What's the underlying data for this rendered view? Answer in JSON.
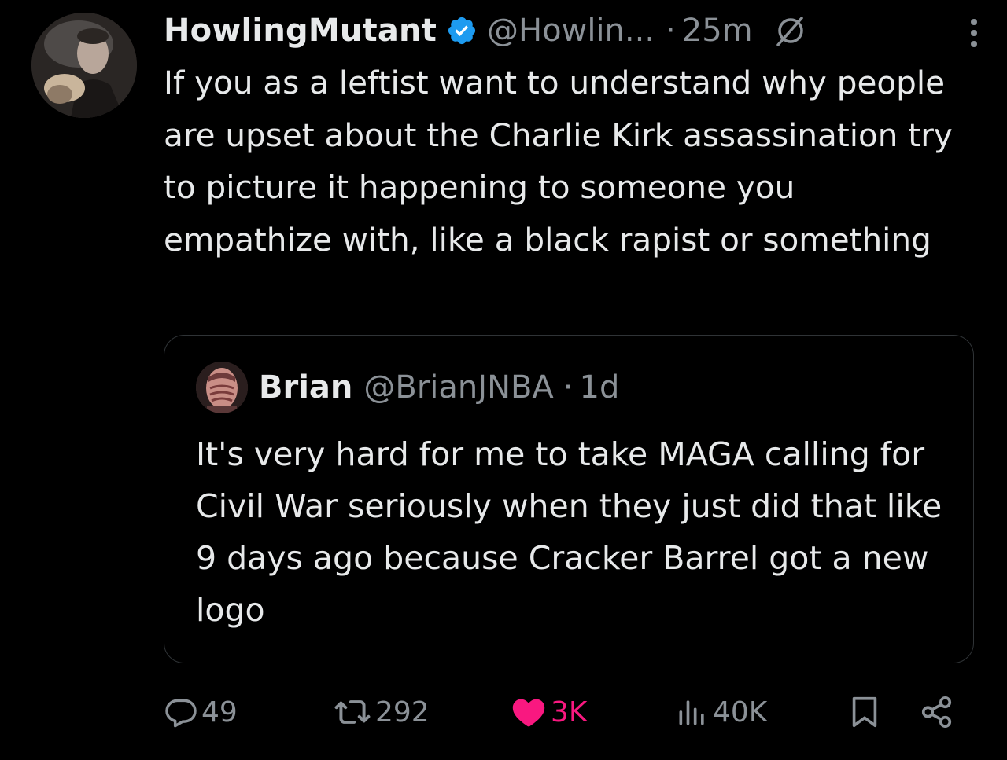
{
  "tweet": {
    "display_name": "HowlingMutant",
    "handle": "@Howlin...",
    "separator": "·",
    "time": "25m",
    "verified_icon": "verified-badge-icon",
    "restricted_icon": "no-entry-icon",
    "more_icon": "more-vertical-icon",
    "text": "If you as a leftist want to understand why people are upset about the Charlie Kirk assassination try to picture it happening to someone you empathize with, like a black rapist or something"
  },
  "quote": {
    "display_name": "Brian",
    "handle": "@BrianJNBA",
    "separator": "·",
    "time": "1d",
    "text": "It's very hard for me to take MAGA calling for Civil War seriously when they just did that like 9 days ago because Cracker Barrel got a new logo"
  },
  "actions": {
    "replies": "49",
    "retweets": "292",
    "likes": "3K",
    "views": "40K",
    "reply_icon": "reply-icon",
    "retweet_icon": "retweet-icon",
    "like_icon": "heart-icon",
    "views_icon": "views-bar-chart-icon",
    "bookmark_icon": "bookmark-icon",
    "share_icon": "share-icon"
  },
  "colors": {
    "background": "#000000",
    "text_primary": "#e7e9ea",
    "text_secondary": "#8b9197",
    "verified_blue": "#1d9bf0",
    "like_pink": "#f91880",
    "border": "#2f3336"
  }
}
